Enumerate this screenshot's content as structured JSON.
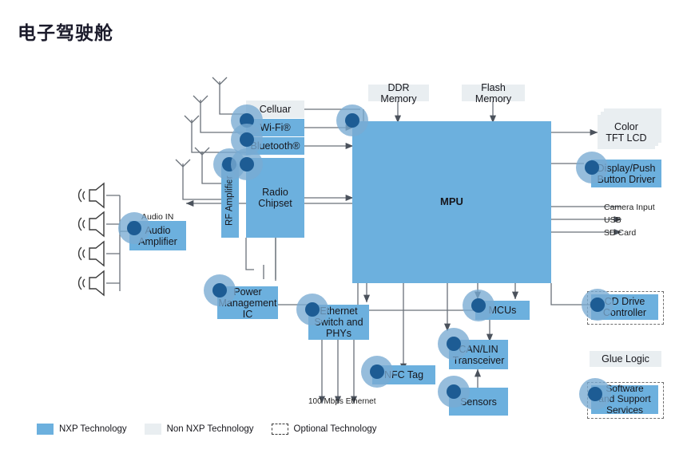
{
  "title": "电子驾驶舱",
  "blocks": {
    "cellular": "Celluar",
    "wifi": "Wi-Fi®",
    "bluetooth": "Bluetooth®",
    "rf_amplifier": "RF Amplifier",
    "radio_chipset": "Radio\nChipset",
    "ddr_memory": "DDR Memory",
    "flash_memory": "Flash Memory",
    "mpu": "MPU",
    "color_tft_lcd": "Color\nTFT LCD",
    "display_push_button_driver": "Display/Push\nButton Driver",
    "audio_amplifier": "Audio\nAmplifier",
    "power_management_ic": "Power\nManagement\nIC",
    "ethernet_switch_phys": "Ethernet\nSwitch and\nPHYs",
    "nfc_tag": "NFC Tag",
    "mcus": "MCUs",
    "can_lin_transceiver": "CAN/LIN\nTransceiver",
    "sensors": "Sensors",
    "cd_drive_controller": "CD Drive\nController",
    "glue_logic": "Glue Logic",
    "software_support_services": "Software\nand Support\nServices"
  },
  "labels": {
    "audio_in": "Audio IN",
    "camera_input": "Camera Input",
    "usb": "USB",
    "sd_card": "SD Card",
    "ethernet_speed": "100 Mbps Ethernet"
  },
  "legend": [
    {
      "label": "NXP Technology",
      "style": "blue"
    },
    {
      "label": "Non NXP Technology",
      "style": "grey"
    },
    {
      "label": "Optional Technology",
      "style": "dash"
    }
  ],
  "colors": {
    "nxp_blue": "#6cb0de",
    "non_nxp_grey": "#e9eef1",
    "node_dot": "#1d5c94",
    "node_halo": "#78aad2",
    "wire": "#59606a",
    "background": "#ffffff"
  }
}
